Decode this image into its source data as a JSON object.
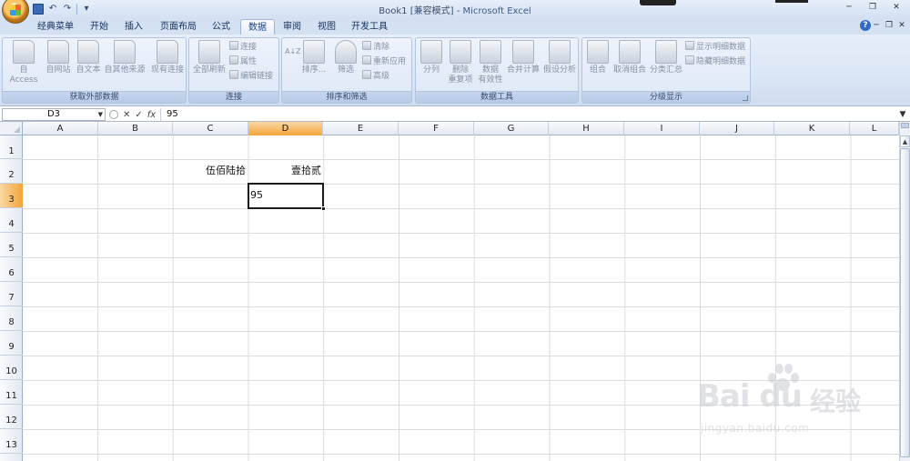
{
  "window": {
    "title": "Book1",
    "mode": "[兼容模式]",
    "separator": " - ",
    "app_name": "Microsoft Excel",
    "min_glyph": "─",
    "restore_glyph": "❐",
    "close_glyph": "✕"
  },
  "quick_access": {
    "undo_glyph": "↶",
    "redo_glyph": "↷",
    "more_glyph": "▾"
  },
  "tabs": [
    {
      "label": "经典菜单",
      "active": false
    },
    {
      "label": "开始",
      "active": false
    },
    {
      "label": "插入",
      "active": false
    },
    {
      "label": "页面布局",
      "active": false
    },
    {
      "label": "公式",
      "active": false
    },
    {
      "label": "数据",
      "active": true
    },
    {
      "label": "审阅",
      "active": false
    },
    {
      "label": "视图",
      "active": false
    },
    {
      "label": "开发工具",
      "active": false
    }
  ],
  "help_glyph": "?",
  "ribbon": {
    "groups": {
      "external": {
        "label": "获取外部数据",
        "buttons": [
          "自 Access",
          "自网站",
          "自文本",
          "自其他来源",
          "现有连接"
        ]
      },
      "connections": {
        "label": "连接",
        "big": "全部刷新",
        "small": [
          "连接",
          "属性",
          "编辑链接"
        ]
      },
      "sort_filter": {
        "label": "排序和筛选",
        "sort": "排序...",
        "filter": "筛选",
        "small": [
          "清除",
          "重新应用",
          "高级"
        ],
        "az_glyph": "A↓Z"
      },
      "data_tools": {
        "label": "数据工具",
        "buttons": [
          "分列",
          "删除\n重复项",
          "数据\n有效性",
          "合并计算",
          "假设分析"
        ]
      },
      "outline": {
        "label": "分级显示",
        "buttons": [
          "组合",
          "取消组合",
          "分类汇总"
        ],
        "small": [
          "显示明细数据",
          "隐藏明细数据"
        ]
      }
    }
  },
  "formula_bar": {
    "name_box": "D3",
    "fx": "fx",
    "cancel_glyph": "✕",
    "enter_glyph": "✓",
    "formula": "95"
  },
  "sheet": {
    "columns": [
      "A",
      "B",
      "C",
      "D",
      "E",
      "F",
      "G",
      "H",
      "I",
      "J",
      "K",
      "L"
    ],
    "rows": [
      "1",
      "2",
      "3",
      "4",
      "5",
      "6",
      "7",
      "8",
      "9",
      "10",
      "11",
      "12",
      "13"
    ],
    "selected_column": "D",
    "selected_row": "3",
    "cells": {
      "C2": "伍佰陆拾",
      "D2": "壹拾贰",
      "D3": "95"
    }
  },
  "watermark": {
    "logo_text": "Bai du",
    "cn_text": "经验",
    "url": "jingyan.baidu.com"
  }
}
